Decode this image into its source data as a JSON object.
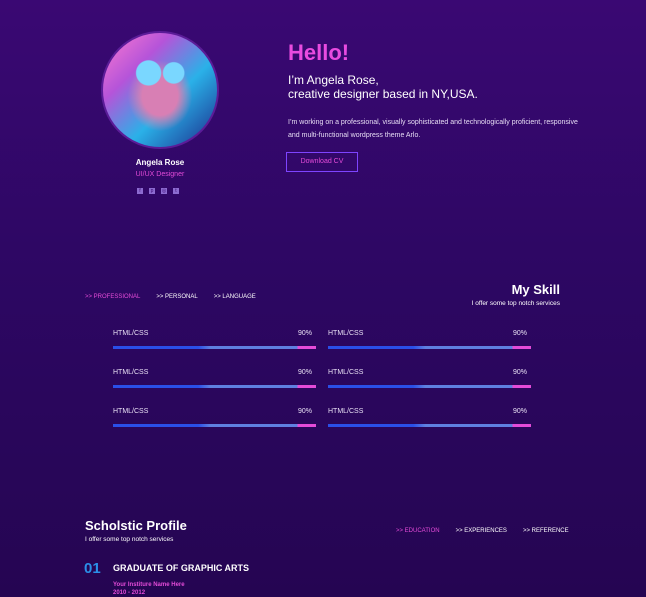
{
  "profile": {
    "name": "Angela Rose",
    "role": "UI/UX Designer",
    "socials": [
      {
        "icon": "facebook-icon",
        "glyph": "f"
      },
      {
        "icon": "pinterest-icon",
        "glyph": "p"
      },
      {
        "icon": "instagram-icon",
        "glyph": "◎"
      },
      {
        "icon": "twitter-icon",
        "glyph": "t"
      }
    ]
  },
  "hero": {
    "hello": "Hello!",
    "intro_line1": "I’m Angela Rose,",
    "intro_line2": "creative designer based in NY,USA.",
    "paragraph": "I’m working on a professional, visually sophisticated and technologically proficient, responsive and multi-functional wordpress theme Arlo.",
    "cv_button": "Download CV"
  },
  "skills": {
    "title": "My Skill",
    "subtitle": "I offer some top notch services",
    "tabs": [
      {
        "label": ">> PROFESSIONAL",
        "active": true
      },
      {
        "label": ">> PERSONAL",
        "active": false
      },
      {
        "label": ">> LANGUAGE",
        "active": false
      }
    ],
    "items": [
      {
        "label": "HTML/CSS",
        "percent": "90%"
      },
      {
        "label": "HTML/CSS",
        "percent": "90%"
      },
      {
        "label": "HTML/CSS",
        "percent": "90%"
      },
      {
        "label": "HTML/CSS",
        "percent": "90%"
      },
      {
        "label": "HTML/CSS",
        "percent": "90%"
      },
      {
        "label": "HTML/CSS",
        "percent": "90%"
      }
    ],
    "bar_colors": {
      "blue": "#2a4fe8",
      "light": "#5f80e0",
      "pink": "#e44bd8"
    }
  },
  "scholastic": {
    "title": "Scholstic Profile",
    "subtitle": "I offer some top notch services",
    "tabs": [
      {
        "label": ">> EDUCATION",
        "active": true
      },
      {
        "label": ">> EXPERIENCES",
        "active": false
      },
      {
        "label": ">> REFERENCE",
        "active": false
      }
    ],
    "entry": {
      "number": "01",
      "degree": "GRADUATE OF GRAPHIC ARTS",
      "institute": "Your Institure Name Here",
      "years": "2010 - 2012"
    }
  },
  "colors": {
    "accent": "#e94be0",
    "background": "#3a0873",
    "number": "#2b8fe8"
  }
}
